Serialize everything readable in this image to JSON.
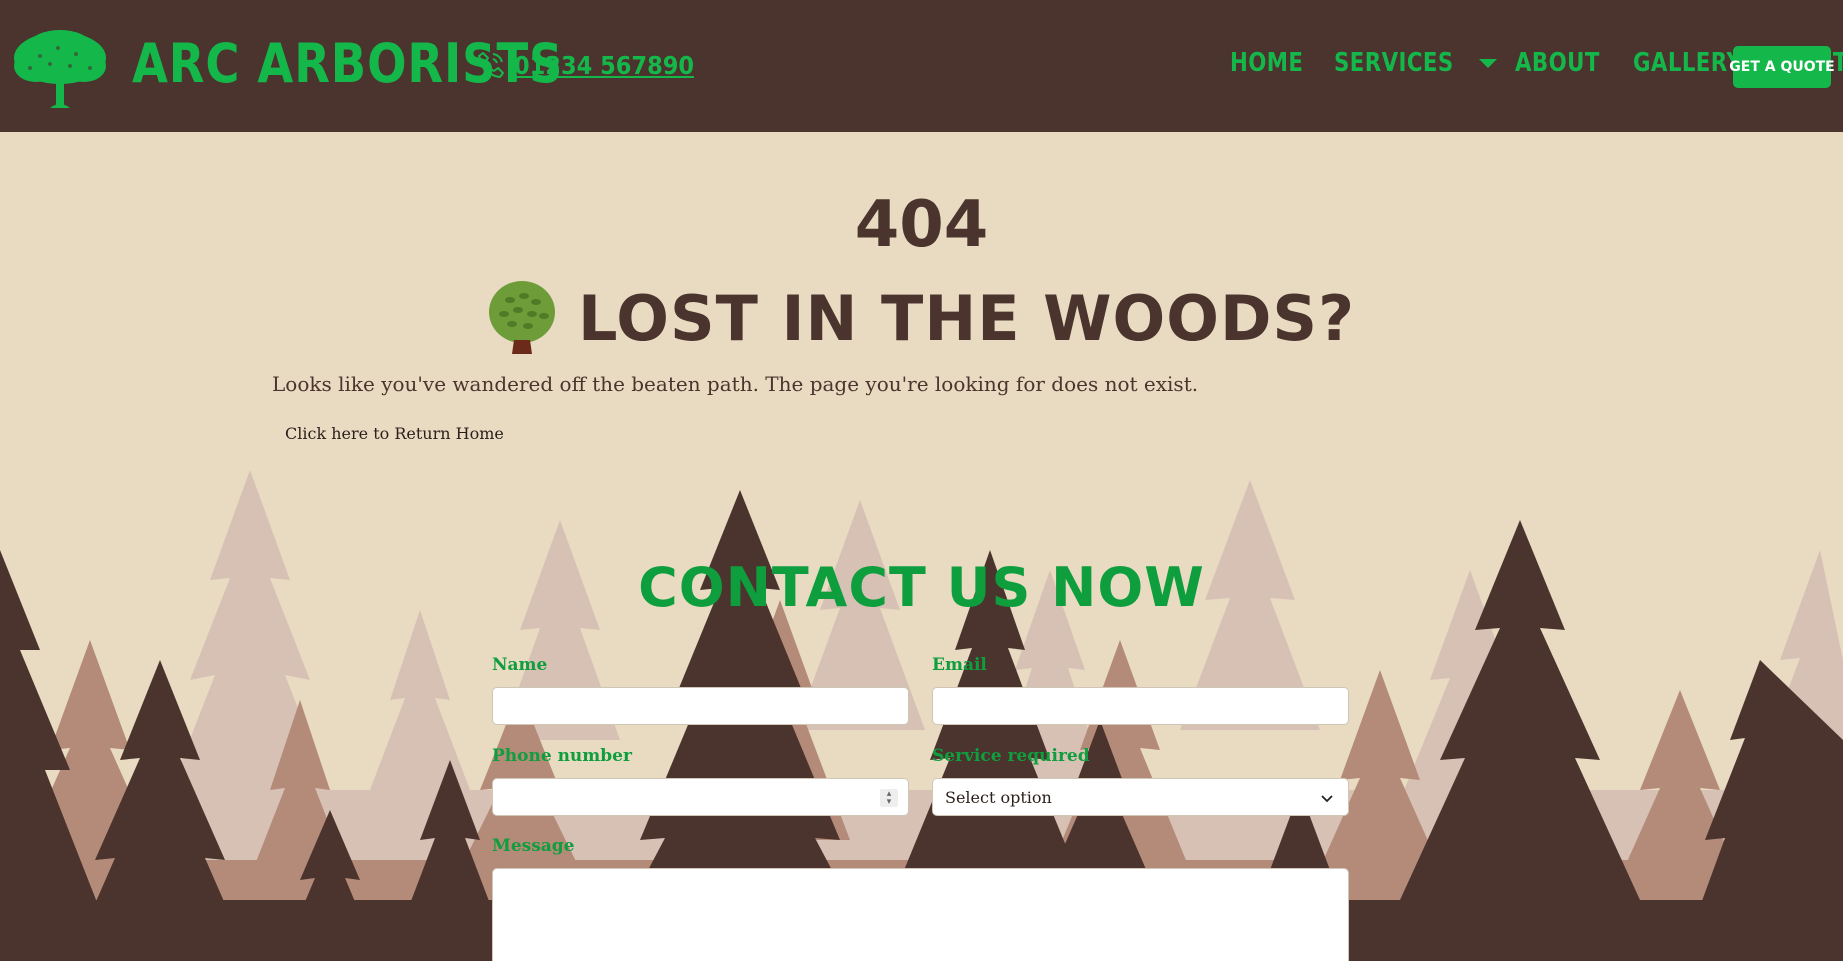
{
  "header": {
    "brand": "ARC ARBORISTS",
    "phone": "01234 567890",
    "nav": [
      "HOME",
      "SERVICES",
      "ABOUT",
      "GALLERY",
      "CONTACT"
    ],
    "cta": "GET A QUOTE"
  },
  "error": {
    "code": "404",
    "title": "LOST IN THE WOODS?",
    "message": "Looks like you've wandered off the beaten path. The page you're looking for does not exist.",
    "return_link": "Click here to Return Home"
  },
  "contact": {
    "title": "CONTACT US NOW",
    "name_label": "Name",
    "email_label": "Email",
    "phone_label": "Phone number",
    "service_label": "Service required",
    "service_value": "Select option",
    "message_label": "Message"
  },
  "colors": {
    "header_bg": "#4a342d",
    "accent_green": "#14b84a",
    "page_bg": "#e9dbc2"
  }
}
